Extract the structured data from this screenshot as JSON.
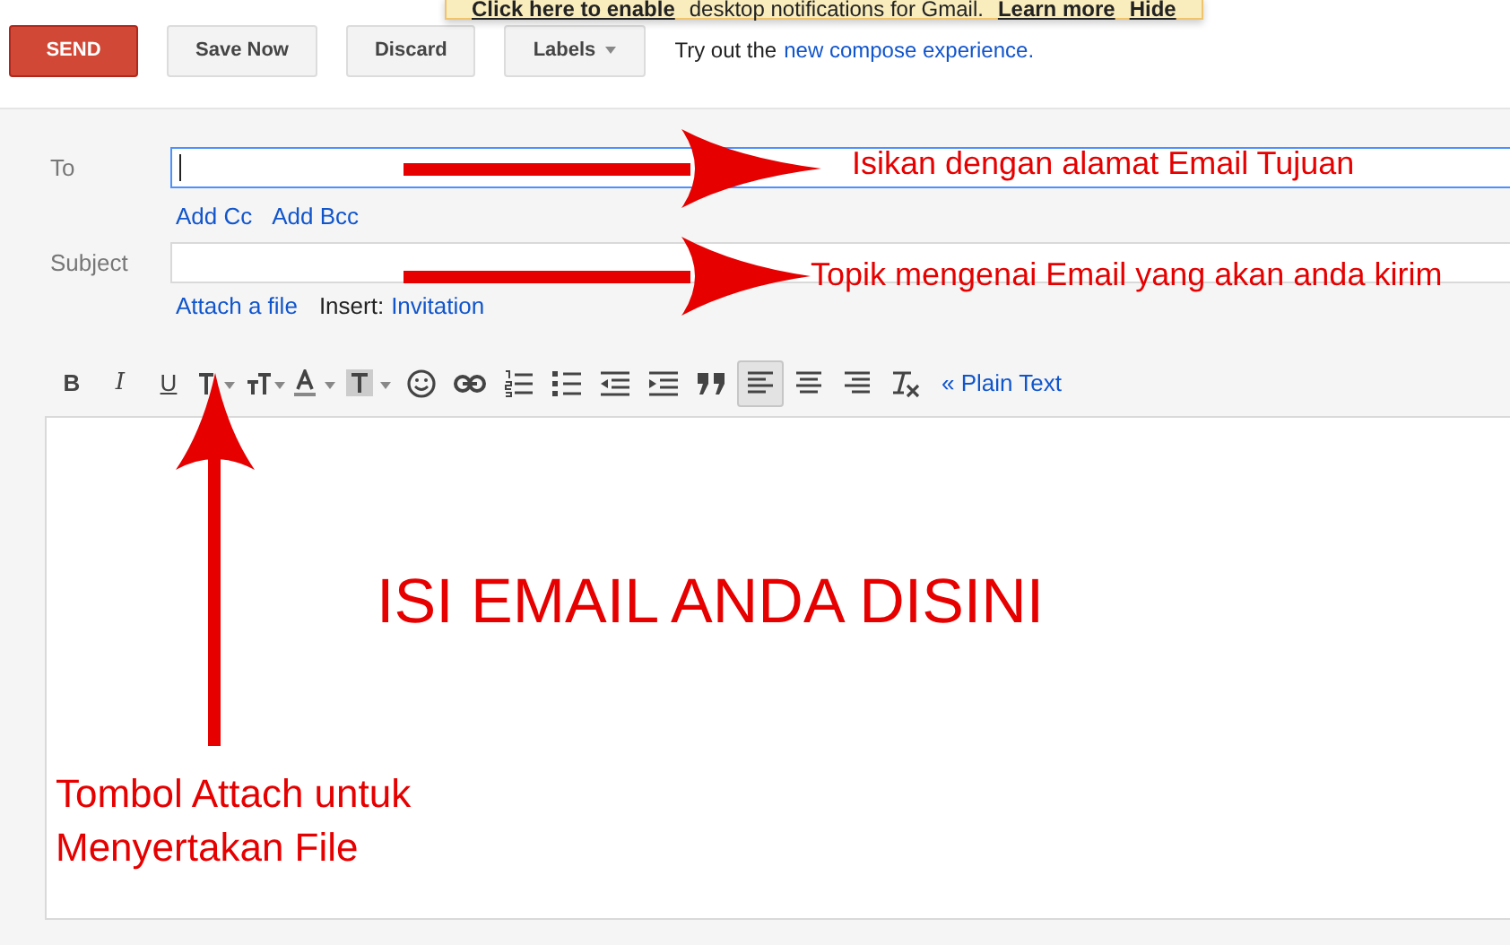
{
  "notification": {
    "text": "Click here to enable",
    "rest": "desktop notifications for Gmail.",
    "links": [
      "Learn more",
      "Hide"
    ]
  },
  "top_bar": {
    "buttons": [
      {
        "label": "SEND",
        "kind": "primary"
      },
      {
        "label": "Save Now",
        "kind": "plain"
      },
      {
        "label": "Discard",
        "kind": "plain"
      },
      {
        "label": "Labels",
        "kind": "menu"
      }
    ],
    "promo": "Try out the",
    "promo_link": "new compose experience."
  },
  "to": {
    "label": "To",
    "focused": true
  },
  "recipient_links": [
    "Add Cc",
    "Add Bcc"
  ],
  "subject": {
    "label": "Subject",
    "focused": false
  },
  "attach_link": "Attach a file",
  "insert_label": "Insert:",
  "insert_link": "Invitation",
  "toolbar": [
    {
      "kind": "bold",
      "label": "B",
      "selected": false
    },
    {
      "kind": "italic",
      "label": "I",
      "selected": false
    },
    {
      "kind": "underline",
      "label": "U",
      "selected": false
    },
    {
      "kind": "font",
      "selected": false
    },
    {
      "kind": "size",
      "selected": false
    },
    {
      "kind": "text-color",
      "selected": false
    },
    {
      "kind": "highlight",
      "selected": false
    },
    {
      "kind": "emoji",
      "selected": false
    },
    {
      "kind": "link",
      "selected": false
    },
    {
      "kind": "numbered-list",
      "selected": false
    },
    {
      "kind": "bulleted-list",
      "selected": false
    },
    {
      "kind": "outdent",
      "selected": false
    },
    {
      "kind": "indent",
      "selected": false
    },
    {
      "kind": "quote",
      "selected": false
    },
    {
      "kind": "align-left",
      "selected": true
    },
    {
      "kind": "align-center",
      "selected": false
    },
    {
      "kind": "align-right",
      "selected": false
    },
    {
      "kind": "clear-format",
      "selected": false
    }
  ],
  "plain_text_link": "« Plain Text",
  "annotations": [
    {
      "kind": "to",
      "text": "Isikan dengan alamat Email Tujuan"
    },
    {
      "kind": "subject",
      "text": "Topik mengenai Email yang akan anda kirim"
    },
    {
      "kind": "body",
      "text": "ISI EMAIL ANDA DISINI"
    },
    {
      "kind": "attach",
      "text": "Tombol Attach untuk Menyertakan File"
    }
  ]
}
